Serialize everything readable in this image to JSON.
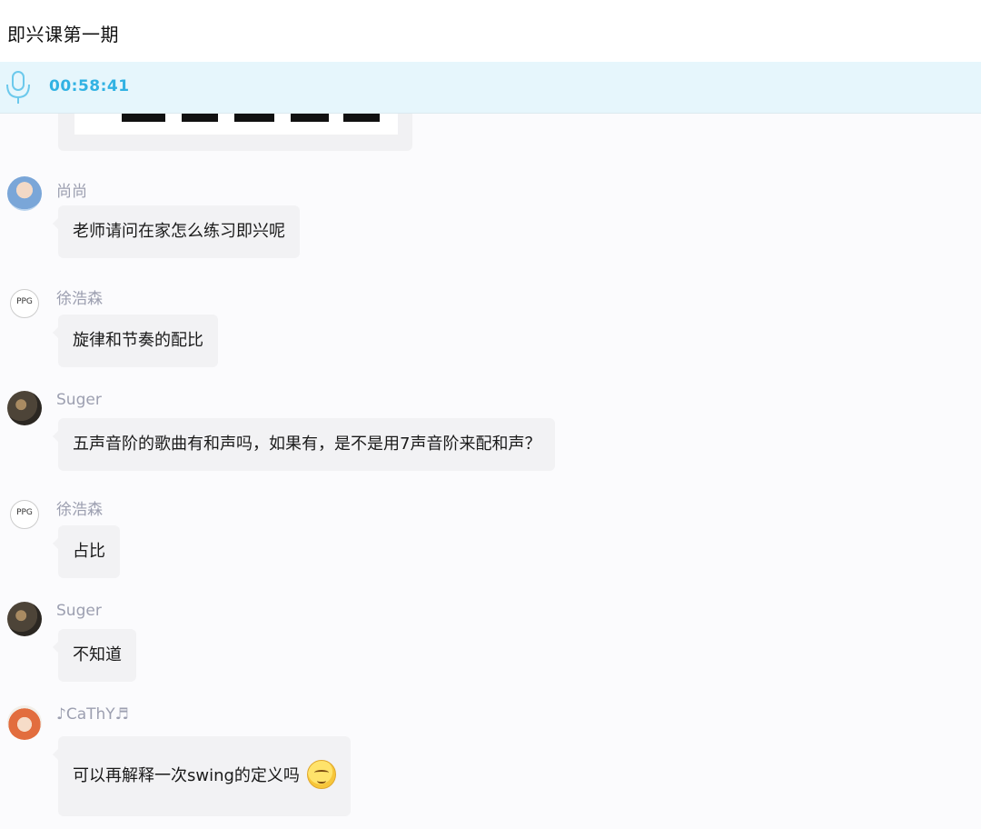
{
  "header": {
    "title": "即兴课第一期"
  },
  "audio": {
    "icon": "microphone-icon",
    "timer": "00:58:41",
    "accent": "#31b2e3"
  },
  "messages": [
    {
      "sender": "尚尚",
      "text": "老师请问在家怎么练习即兴呢"
    },
    {
      "sender": "徐浩森",
      "avatar_text": "PPG",
      "text": "旋律和节奏的配比"
    },
    {
      "sender": "Suger",
      "text": "五声音阶的歌曲有和声吗，如果有，是不是用7声音阶来配和声？"
    },
    {
      "sender": "徐浩森",
      "avatar_text": "PPG",
      "text": "占比"
    },
    {
      "sender": "Suger",
      "text": "不知道"
    },
    {
      "sender": "♪CaThY♬",
      "text": "可以再解释一次swing的定义吗",
      "emoji": "relieved-face-emoji"
    }
  ]
}
